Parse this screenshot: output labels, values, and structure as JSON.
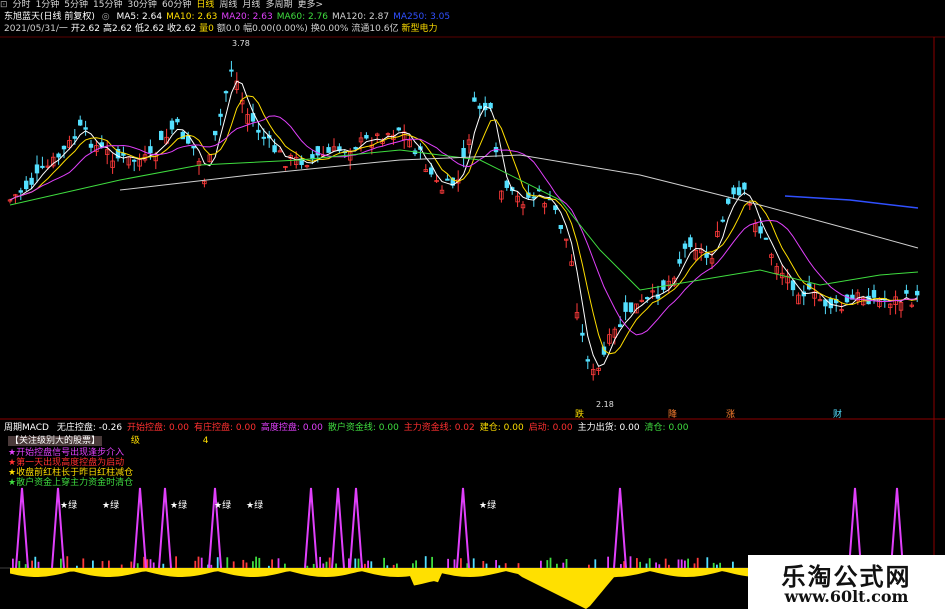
{
  "toolbar": {
    "items": [
      "分时",
      "1分钟",
      "5分钟",
      "15分钟",
      "30分钟",
      "60分钟",
      "日线",
      "周线",
      "月线",
      "多周期",
      "更多>"
    ],
    "active_index": 6
  },
  "header": {
    "stock_name": "东旭蓝天(日线 前复权)",
    "ma": [
      {
        "label": "MA5: 2.64",
        "color": "#ffffff"
      },
      {
        "label": "MA10: 2.63",
        "color": "#ffde00"
      },
      {
        "label": "MA20: 2.63",
        "color": "#e040fb"
      },
      {
        "label": "MA60: 2.76",
        "color": "#3fdc3f"
      },
      {
        "label": "MA120: 2.87",
        "color": "#d0d0d0"
      },
      {
        "label": "MA250: 3.05",
        "color": "#3050ff"
      }
    ],
    "quote": [
      {
        "label": "2021/05/31/一",
        "color": "#cfcfcf"
      },
      {
        "label": "开2.62",
        "color": "#ffffff"
      },
      {
        "label": "高2.62",
        "color": "#ffffff"
      },
      {
        "label": "低2.62",
        "color": "#ffffff"
      },
      {
        "label": "收2.62",
        "color": "#ffffff"
      },
      {
        "label": "量0",
        "color": "#ffde00"
      },
      {
        "label": "额0.0",
        "color": "#cfcfcf"
      },
      {
        "label": "幅0.00(0.00%)",
        "color": "#cfcfcf"
      },
      {
        "label": "换0.00%",
        "color": "#cfcfcf"
      },
      {
        "label": "流通10.6亿",
        "color": "#cfcfcf"
      },
      {
        "label": "新型电力",
        "color": "#ffde00"
      }
    ]
  },
  "price_labels": {
    "high": "3.78",
    "low": "2.18"
  },
  "markers": [
    "跌",
    "降",
    "涨",
    "财"
  ],
  "indicator": {
    "title": "周期MACD",
    "fields": [
      {
        "label": "无庄控盘: -0.26",
        "color": "#ffffff"
      },
      {
        "label": "开始控盘: 0.00",
        "color": "#ff3030"
      },
      {
        "label": "有庄控盘: 0.00",
        "color": "#ff3030"
      },
      {
        "label": "高度控盘: 0.00",
        "color": "#e040fb"
      },
      {
        "label": "散户资金线: 0.00",
        "color": "#3fdc3f"
      },
      {
        "label": "主力资金线: 0.02",
        "color": "#ff3030"
      },
      {
        "label": "建仓: 0.00",
        "color": "#ffde00"
      },
      {
        "label": "启动: 0.00",
        "color": "#ff3030"
      },
      {
        "label": "主力出货: 0.00",
        "color": "#ffffff"
      },
      {
        "label": "清仓: 0.00",
        "color": "#3fdc3f"
      }
    ],
    "level_label": "级",
    "level_value": "4",
    "focus_text": "【关注级别大的股票】",
    "legend": [
      {
        "text": "★开始控盘信号出现逢步介入",
        "color": "#e040fb"
      },
      {
        "text": "★第一天出现高度控盘为启动",
        "color": "#ff3030"
      },
      {
        "text": "★收盘前红柱长于昨日红柱减仓",
        "color": "#ffde00"
      },
      {
        "text": "★散户资金上穿主力资金时清仓",
        "color": "#3fdc3f"
      }
    ],
    "star_label": "★绿"
  },
  "watermark": {
    "title": "乐淘公式网",
    "url": "www.60lt.com"
  }
}
